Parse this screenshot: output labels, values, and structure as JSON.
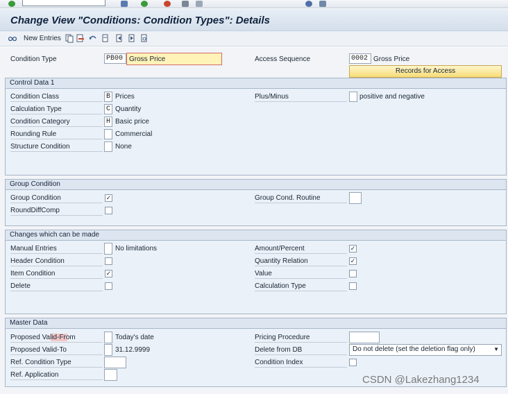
{
  "page": {
    "title": "Change View \"Conditions: Condition Types\": Details"
  },
  "toolbar": {
    "new_entries": "New Entries"
  },
  "header_section": {
    "condition_type_label": "Condition Type",
    "condition_type_value": "PB00",
    "condition_type_desc": "Gross Price",
    "access_sequence_label": "Access Sequence",
    "access_sequence_value": "0002",
    "access_sequence_desc": "Gross Price",
    "records_button": "Records for Access"
  },
  "control_data": {
    "title": "Control Data 1",
    "condition_class": {
      "label": "Condition Class",
      "value": "B",
      "desc": "Prices"
    },
    "calculation_type": {
      "label": "Calculation Type",
      "value": "C",
      "desc": "Quantity"
    },
    "condition_category": {
      "label": "Condition Category",
      "value": "H",
      "desc": "Basic price"
    },
    "rounding_rule": {
      "label": "Rounding Rule",
      "value": "",
      "desc": "Commercial"
    },
    "structure_condition": {
      "label": "Structure Condition",
      "value": "",
      "desc": "None"
    },
    "plus_minus": {
      "label": "Plus/Minus",
      "value": "",
      "desc": "positive and negative"
    }
  },
  "group_condition": {
    "title": "Group Condition",
    "group_condition_label": "Group Condition",
    "group_condition_checked": "✓",
    "round_diff_label": "RoundDiffComp",
    "round_diff_checked": "",
    "routine_label": "Group Cond. Routine",
    "routine_value": ""
  },
  "changes": {
    "title": "Changes which can be made",
    "manual_entries": {
      "label": "Manual Entries",
      "value": "",
      "desc": "No limitations"
    },
    "header_condition": {
      "label": "Header Condition",
      "checked": ""
    },
    "item_condition": {
      "label": "Item Condition",
      "checked": "✓"
    },
    "delete": {
      "label": "Delete",
      "checked": ""
    },
    "amount_percent": {
      "label": "Amount/Percent",
      "checked": "✓"
    },
    "quantity_relation": {
      "label": "Quantity Relation",
      "checked": "✓"
    },
    "value": {
      "label": "Value",
      "checked": ""
    },
    "calculation_type": {
      "label": "Calculation Type",
      "checked": ""
    }
  },
  "master_data": {
    "title": "Master Data",
    "valid_from": {
      "label": "Proposed Valid-From",
      "value": "",
      "desc": "Today's date"
    },
    "valid_to": {
      "label": "Proposed Valid-To",
      "value": "",
      "desc": "31.12.9999"
    },
    "ref_condition_type": {
      "label": "Ref. Condition Type",
      "value": ""
    },
    "ref_application": {
      "label": "Ref. Application",
      "value": ""
    },
    "pricing_procedure": {
      "label": "Pricing Procedure",
      "value": ""
    },
    "delete_from_db": {
      "label": "Delete from DB",
      "value": "Do not delete (set the deletion flag only)"
    },
    "condition_index": {
      "label": "Condition Index",
      "checked": ""
    }
  },
  "watermark": "CSDN @Lakezhang1234",
  "colors": {
    "header_bg": "#d4dfeb",
    "box_bg": "#eaf1f8",
    "button_bg": "#f6dc77",
    "highlight": "#fff3b8"
  }
}
